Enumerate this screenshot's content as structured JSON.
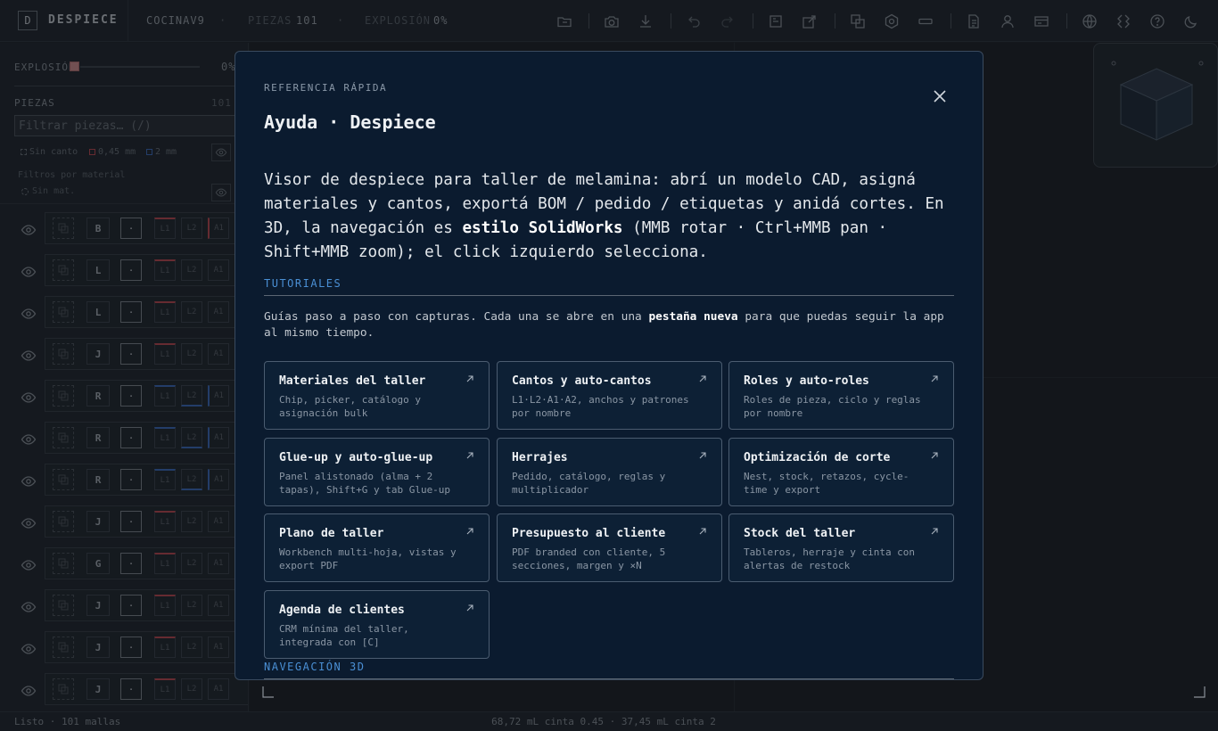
{
  "topbar": {
    "logo_letter": "D",
    "app_name": "DESPIECE",
    "project": "COCINAV9",
    "pieces_label": "PIEZAS",
    "pieces_count": "101",
    "explosion_label": "EXPLOSIÓN",
    "explosion_value": "0%",
    "dot": "·"
  },
  "sidebar": {
    "explosion_label": "EXPLOSIÓN",
    "explosion_value": "0%",
    "explosion_level_percent": 0,
    "pieces_header": "PIEZAS",
    "pieces_count": "101",
    "filter_placeholder": "Filtrar piezas… (/)",
    "legend": {
      "no_edge": "Sin canto",
      "edge_045": "0,45 mm",
      "edge_2": "2 mm"
    },
    "material_filters_label": "Filtros por material",
    "no_material": "Sin mat.",
    "rows": [
      {
        "material": "B",
        "role": "·",
        "l1": "L1",
        "l2": "L2",
        "a1": "A1"
      },
      {
        "material": "L",
        "role": "·",
        "l1": "L1",
        "l2": "L2",
        "a1": "A1"
      },
      {
        "material": "L",
        "role": "·",
        "l1": "L1",
        "l2": "L2",
        "a1": "A1"
      },
      {
        "material": "J",
        "role": "·",
        "l1": "L1",
        "l2": "L2",
        "a1": "A1"
      },
      {
        "material": "R",
        "role": "·",
        "l1": "L1",
        "l2": "L2",
        "a1": "A1"
      },
      {
        "material": "R",
        "role": "·",
        "l1": "L1",
        "l2": "L2",
        "a1": "A1"
      },
      {
        "material": "R",
        "role": "·",
        "l1": "L1",
        "l2": "L2",
        "a1": "A1"
      },
      {
        "material": "J",
        "role": "·",
        "l1": "L1",
        "l2": "L2",
        "a1": "A1"
      },
      {
        "material": "G",
        "role": "·",
        "l1": "L1",
        "l2": "L2",
        "a1": "A1"
      },
      {
        "material": "J",
        "role": "·",
        "l1": "L1",
        "l2": "L2",
        "a1": "A1"
      },
      {
        "material": "J",
        "role": "·",
        "l1": "L1",
        "l2": "L2",
        "a1": "A1"
      },
      {
        "material": "J",
        "role": "·",
        "l1": "L1",
        "l2": "L2",
        "a1": "A1"
      }
    ]
  },
  "statusbar": {
    "left": "Listo · 101 mallas",
    "center": "68,72 mL cinta 0.45 · 37,45 mL cinta 2"
  },
  "modal": {
    "kicker": "REFERENCIA RÁPIDA",
    "title": "Ayuda · Despiece",
    "intro_1": "Visor de despiece para taller de melamina: abrí un modelo CAD, asigná materiales y cantos, exportá BOM / pedido / etiquetas y anidá cortes. En 3D, la navegación es ",
    "intro_bold": "estilo SolidWorks",
    "intro_2": " (MMB rotar · Ctrl+MMB pan · Shift+MMB zoom); el click izquierdo selecciona.",
    "tutorials_heading": "TUTORIALES",
    "tutorials_desc_1": "Guías paso a paso con capturas. Cada una se abre en una ",
    "tutorials_desc_bold": "pestaña nueva",
    "tutorials_desc_2": " para que puedas seguir la app al mismo tiempo.",
    "cards": [
      {
        "title": "Materiales del taller",
        "sub": "Chip, picker, catálogo y asignación bulk"
      },
      {
        "title": "Cantos y auto-cantos",
        "sub": "L1·L2·A1·A2, anchos y patrones por nombre"
      },
      {
        "title": "Roles y auto-roles",
        "sub": "Roles de pieza, ciclo y reglas por nombre"
      },
      {
        "title": "Glue-up y auto-glue-up",
        "sub": "Panel alistonado (alma + 2 tapas), Shift+G y tab Glue-up"
      },
      {
        "title": "Herrajes",
        "sub": "Pedido, catálogo, reglas y multiplicador"
      },
      {
        "title": "Optimización de corte",
        "sub": "Nest, stock, retazos, cycle-time y export"
      },
      {
        "title": "Plano de taller",
        "sub": "Workbench multi-hoja, vistas y export PDF"
      },
      {
        "title": "Presupuesto al cliente",
        "sub": "PDF branded con cliente, 5 secciones, margen y ×N"
      },
      {
        "title": "Stock del taller",
        "sub": "Tableros, herraje y cinta con alertas de restock"
      },
      {
        "title": "Agenda de clientes",
        "sub": "CRM mínima del taller, integrada con [C]"
      }
    ],
    "nav_heading": "NAVEGACIÓN 3D"
  },
  "colors": {
    "accent_blue": "#4a8fd4",
    "edge_red": "#c0464e",
    "edge_blue": "#3a6bbf",
    "modal_bg": "#0b1b2f"
  }
}
